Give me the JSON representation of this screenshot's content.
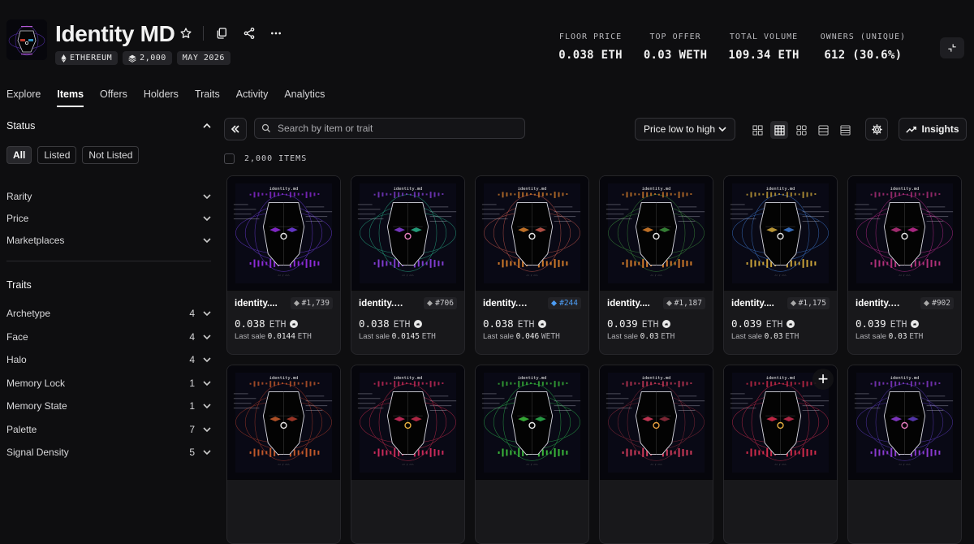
{
  "collection": {
    "title": "Identity MD",
    "badges": [
      {
        "icon": "ethereum-icon",
        "label": "ETHEREUM"
      },
      {
        "icon": "layers-icon",
        "label": "2,000"
      },
      {
        "icon": "",
        "label": "MAY 2026"
      }
    ]
  },
  "stats": [
    {
      "label": "FLOOR PRICE",
      "value": "0.038 ETH"
    },
    {
      "label": "TOP OFFER",
      "value": "0.03 WETH"
    },
    {
      "label": "TOTAL VOLUME",
      "value": "109.34 ETH"
    },
    {
      "label": "OWNERS (UNIQUE)",
      "value": "612 (30.6%)"
    }
  ],
  "tabs": [
    "Explore",
    "Items",
    "Offers",
    "Holders",
    "Traits",
    "Activity",
    "Analytics"
  ],
  "active_tab": "Items",
  "sidebar": {
    "status_title": "Status",
    "status_chips": [
      "All",
      "Listed",
      "Not Listed"
    ],
    "filters": [
      "Rarity",
      "Price",
      "Marketplaces"
    ],
    "traits_title": "Traits",
    "traits": [
      {
        "name": "Archetype",
        "count": "4"
      },
      {
        "name": "Face",
        "count": "4"
      },
      {
        "name": "Halo",
        "count": "4"
      },
      {
        "name": "Memory Lock",
        "count": "1"
      },
      {
        "name": "Memory State",
        "count": "1"
      },
      {
        "name": "Palette",
        "count": "7"
      },
      {
        "name": "Signal Density",
        "count": "5"
      }
    ]
  },
  "toolbar": {
    "search_placeholder": "Search by item or trait",
    "sort_label": "Price low to high",
    "insights_label": "Insights",
    "items_count": "2,000 ITEMS"
  },
  "items": [
    {
      "name": "identity.md",
      "display": "identity....",
      "id": "#1,739",
      "price": "0.038",
      "currency": "ETH",
      "last_sale": "0.0144",
      "last_cur": "ETH",
      "rare": false,
      "accent": "#8c2bd6",
      "eye": "#e8e8e8",
      "halo": "#6b3bd6"
    },
    {
      "name": "identity.md",
      "display": "identity.m...",
      "id": "#706",
      "price": "0.038",
      "currency": "ETH",
      "last_sale": "0.0145",
      "last_cur": "ETH",
      "rare": false,
      "accent": "#7f3ccf",
      "eye": "#e87fc0",
      "halo": "#27a884"
    },
    {
      "name": "identity.md",
      "display": "identity.m...",
      "id": "#244",
      "price": "0.038",
      "currency": "ETH",
      "last_sale": "0.046",
      "last_cur": "WETH",
      "rare": true,
      "accent": "#d07a2a",
      "eye": "#e8e8e8",
      "halo": "#c0554a"
    },
    {
      "name": "identity.md",
      "display": "identity....",
      "id": "#1,187",
      "price": "0.039",
      "currency": "ETH",
      "last_sale": "0.03",
      "last_cur": "ETH",
      "rare": false,
      "accent": "#d07a2a",
      "eye": "#e8e8e8",
      "halo": "#3a8a3a"
    },
    {
      "name": "identity.md",
      "display": "identity....",
      "id": "#1,175",
      "price": "0.039",
      "currency": "ETH",
      "last_sale": "0.03",
      "last_cur": "ETH",
      "rare": false,
      "accent": "#c9a23a",
      "eye": "#e8e8e8",
      "halo": "#3b74c9"
    },
    {
      "name": "identity.md",
      "display": "identity.m...",
      "id": "#902",
      "price": "0.039",
      "currency": "ETH",
      "last_sale": "0.03",
      "last_cur": "ETH",
      "rare": false,
      "accent": "#b0307a",
      "eye": "#e8e8e8",
      "halo": "#b82a8c"
    },
    {
      "name": "identity.md",
      "display": "",
      "id": "",
      "price": "",
      "currency": "",
      "last_sale": "",
      "last_cur": "",
      "rare": false,
      "accent": "#c0582a",
      "eye": "#e8e8e8",
      "halo": "#a83a2a"
    },
    {
      "name": "identity.md",
      "display": "",
      "id": "",
      "price": "",
      "currency": "",
      "last_sale": "",
      "last_cur": "",
      "rare": false,
      "accent": "#c92a5a",
      "eye": "#e8b040",
      "halo": "#c02a4a"
    },
    {
      "name": "identity.md",
      "display": "",
      "id": "",
      "price": "",
      "currency": "",
      "last_sale": "",
      "last_cur": "",
      "rare": false,
      "accent": "#3ab83a",
      "eye": "#e8e8e8",
      "halo": "#2aa84a"
    },
    {
      "name": "identity.md",
      "display": "",
      "id": "",
      "price": "",
      "currency": "",
      "last_sale": "",
      "last_cur": "",
      "rare": false,
      "accent": "#d03a5a",
      "eye": "#e8a040",
      "halo": "#8a2a3a"
    },
    {
      "name": "identity.md",
      "display": "",
      "id": "",
      "price": "",
      "currency": "",
      "last_sale": "",
      "last_cur": "",
      "rare": false,
      "accent": "#d02a4a",
      "eye": "#e8b040",
      "halo": "#c02a4a"
    },
    {
      "name": "identity.md",
      "display": "",
      "id": "",
      "price": "",
      "currency": "",
      "last_sale": "",
      "last_cur": "",
      "rare": false,
      "accent": "#8a3ad0",
      "eye": "#e87fc0",
      "halo": "#5a3ab8"
    }
  ],
  "colors": {
    "background": "#0e0e10",
    "card": "#18181b",
    "accent_blue": "#4d9df5"
  }
}
